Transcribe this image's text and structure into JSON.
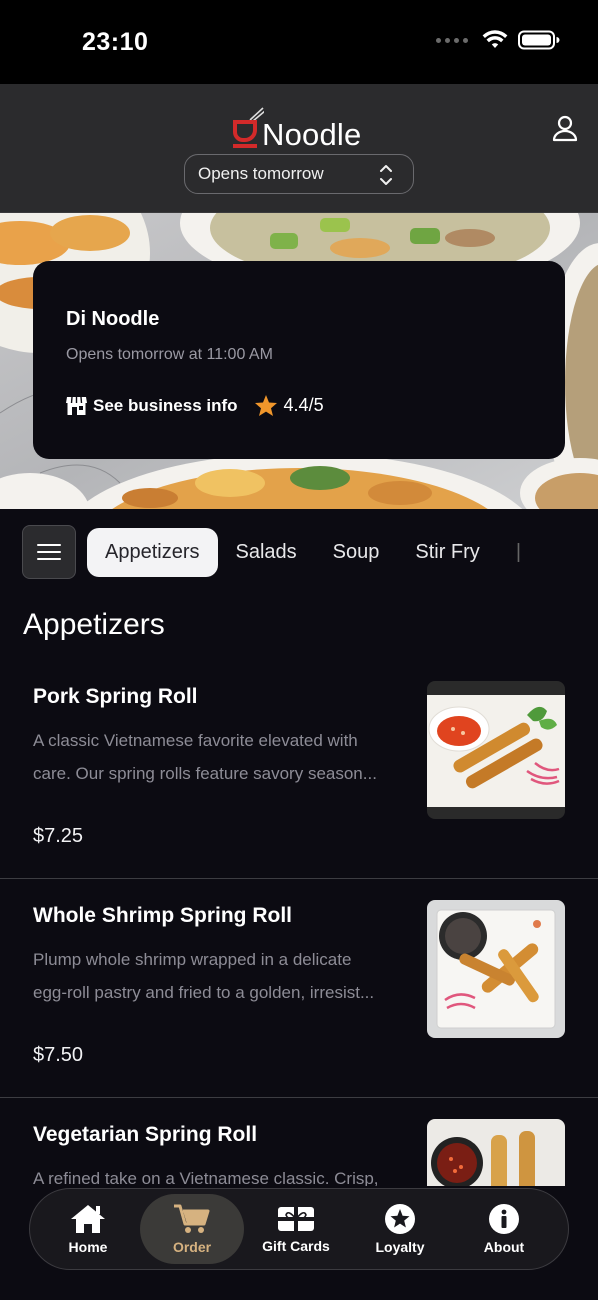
{
  "status_bar": {
    "time": "23:10"
  },
  "header": {
    "logo_text": "Noodle",
    "store_select": {
      "value": "Opens tomorrow"
    }
  },
  "business": {
    "name": "Di Noodle",
    "hours": "Opens tomorrow at 11:00 AM",
    "info_link": "See business info",
    "rating_text": "4.4/5",
    "rating_value": 4.4
  },
  "categories": {
    "tabs": [
      "Appetizers",
      "Salads",
      "Soup",
      "Stir Fry"
    ],
    "active": "Appetizers"
  },
  "section_title": "Appetizers",
  "items": [
    {
      "name": "Pork Spring Roll",
      "desc_line1": "A classic Vietnamese favorite elevated with",
      "desc_line2": "care. Our spring rolls feature savory season...",
      "price": "$7.25",
      "photo": "spring-roll-photo"
    },
    {
      "name": "Whole Shrimp Spring Roll",
      "desc_line1": "Plump whole shrimp wrapped in a delicate",
      "desc_line2": "egg-roll pastry and fried to a golden, irresist...",
      "price": "$7.50",
      "photo": "shrimp-roll-photo"
    },
    {
      "name": "Vegetarian Spring Roll",
      "desc_line1": "A refined take on a Vietnamese classic. Crisp,",
      "desc_line2": "",
      "price": "",
      "photo": "vegetarian-roll-photo"
    }
  ],
  "tab_bar": {
    "tabs": [
      {
        "label": "Home",
        "icon": "home-icon"
      },
      {
        "label": "Order",
        "icon": "cart-icon"
      },
      {
        "label": "Gift Cards",
        "icon": "gift-card-icon"
      },
      {
        "label": "Loyalty",
        "icon": "star-icon"
      },
      {
        "label": "About",
        "icon": "info-icon"
      }
    ],
    "active": "Order"
  },
  "colors": {
    "background": "#0c0b12",
    "header": "#2b2b2d",
    "accent_red": "#d32a2a",
    "active_tab_label": "#d6b280",
    "star": "#f0962b"
  }
}
